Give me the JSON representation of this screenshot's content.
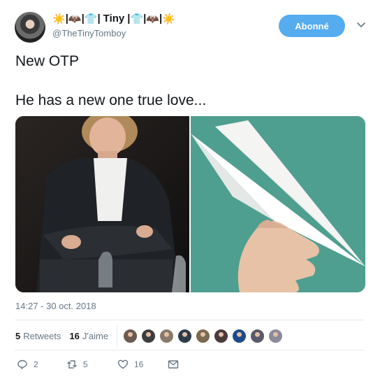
{
  "author": {
    "name": "Tiny",
    "handle": "@TheTinyTomboy",
    "emoji_sun": "☀️",
    "emoji_bat": "🦇",
    "emoji_shirt": "👕",
    "sep": "|"
  },
  "follow_button": {
    "label": "Abonné",
    "color": "#55acee"
  },
  "tweet": {
    "line1": "New OTP",
    "line2": "He has a new one true love..."
  },
  "timestamp": "14:27 - 30 oct. 2018",
  "stats": {
    "retweets_count": "5",
    "retweets_label": "Retweets",
    "likes_count": "16",
    "likes_label": "J'aime"
  },
  "likers": [
    "#6b5a4e",
    "#3d3d3d",
    "#8a7a6a",
    "#2d3b4a",
    "#7a6a50",
    "#4a3a3a",
    "#1e4a8a",
    "#5a5a6a",
    "#8a8a9a"
  ],
  "actions": {
    "reply_count": "2",
    "retweet_count": "5",
    "like_count": "16"
  },
  "icons": {
    "reply": "reply-icon",
    "retweet": "retweet-icon",
    "like": "heart-icon",
    "dm": "envelope-icon",
    "caret": "chevron-down-icon"
  }
}
